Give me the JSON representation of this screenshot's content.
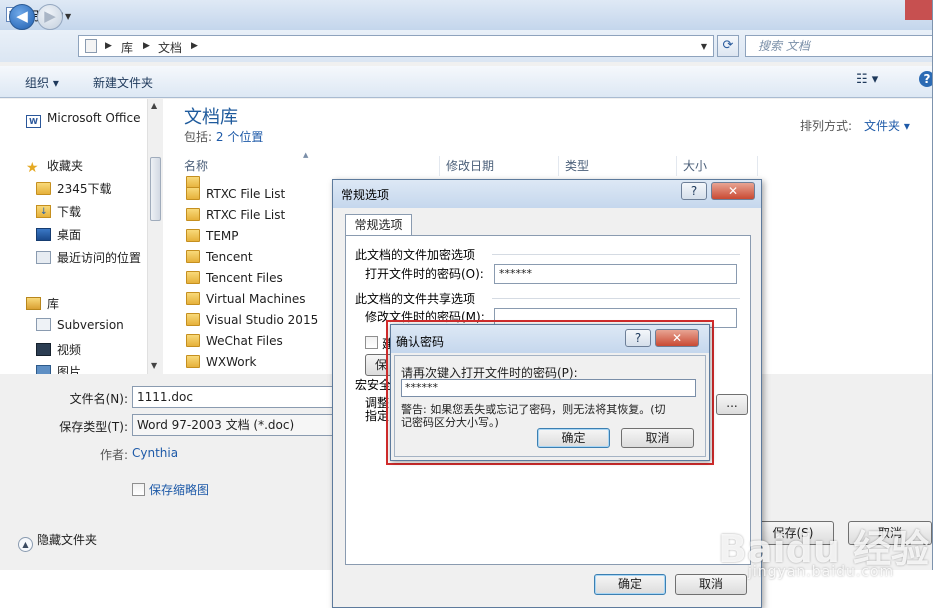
{
  "window": {
    "title": "另存为",
    "app_icon": "W"
  },
  "nav": {
    "back_icon": "◀",
    "forward_icon": "▶",
    "breadcrumb": [
      "库",
      "文档"
    ],
    "search_placeholder": "搜索 文档"
  },
  "toolbar": {
    "organize": "组织 ▾",
    "new_folder": "新建文件夹"
  },
  "sidebar": {
    "items": [
      {
        "label": "Microsoft Office",
        "icon": "word-icon"
      },
      {
        "label": "收藏夹",
        "icon": "star-icon"
      },
      {
        "label": "2345下载",
        "icon": "folder-icon"
      },
      {
        "label": "下载",
        "icon": "download-folder-icon"
      },
      {
        "label": "桌面",
        "icon": "desktop-icon"
      },
      {
        "label": "最近访问的位置",
        "icon": "recent-places-icon"
      },
      {
        "label": "库",
        "icon": "library-icon"
      },
      {
        "label": "Subversion",
        "icon": "library-icon"
      },
      {
        "label": "视频",
        "icon": "video-icon"
      },
      {
        "label": "图片",
        "icon": "picture-icon"
      }
    ]
  },
  "library": {
    "title": "文档库",
    "includes_label": "包括:",
    "includes_link": "2 个位置",
    "arrange_label": "排列方式:",
    "arrange_value": "文件夹 ▾"
  },
  "columns": [
    "名称",
    "修改日期",
    "类型",
    "大小"
  ],
  "files": [
    "RTXC File List",
    "RTXC File List",
    "TEMP",
    "Tencent",
    "Tencent Files",
    "Virtual Machines",
    "Visual Studio 2015",
    "WeChat Files",
    "WXWork"
  ],
  "form": {
    "filename_label": "文件名(N):",
    "filename_value": "1111.doc",
    "type_label": "保存类型(T):",
    "type_value": "Word 97-2003 文档 (*.doc)",
    "author_label": "作者:",
    "author_value": "Cynthia",
    "thumbnail_label": "保存缩略图",
    "hide_folders": "隐藏文件夹",
    "save_button": "保存(S)",
    "cancel_button": "取消"
  },
  "general_options": {
    "title": "常规选项",
    "help": "?",
    "tab": "常规选项",
    "encrypt_section": "此文档的文件加密选项",
    "open_password_label": "打开文件时的密码(O):",
    "open_password_value": "******",
    "share_section": "此文档的文件共享选项",
    "modify_password_label": "修改文件时的密码(M):",
    "readonly_fragment": "建",
    "protect_fragment": "保",
    "macro_fragment": "宏安全",
    "adjust_fragment": "调整",
    "specify_fragment": "指定",
    "ok": "确定",
    "cancel": "取消"
  },
  "confirm": {
    "title": "确认密码",
    "help": "?",
    "prompt": "请再次键入打开文件时的密码(P):",
    "password_value": "******",
    "warning_line1": "警告: 如果您丢失或忘记了密码，则无法将其恢复。(切",
    "warning_line2": "记密码区分大小写。)",
    "ok": "确定",
    "cancel": "取消"
  },
  "watermark": {
    "brand": "Baidu 经验",
    "url": "jingyan.baidu.com"
  }
}
